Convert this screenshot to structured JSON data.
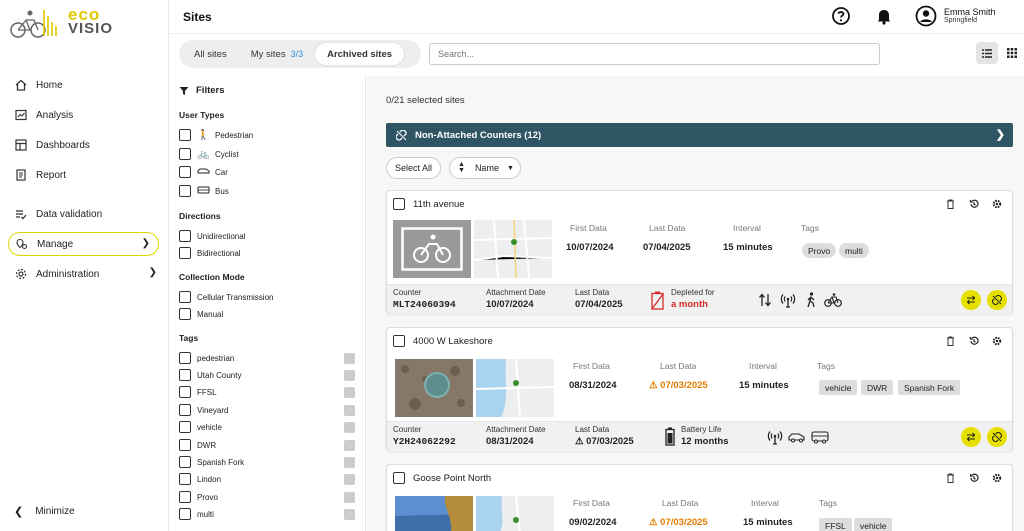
{
  "app": {
    "logo_top": "eco",
    "logo_bottom": "VISIO"
  },
  "sidebar": {
    "items": [
      {
        "label": "Home",
        "icon": "home-icon"
      },
      {
        "label": "Analysis",
        "icon": "analysis-icon"
      },
      {
        "label": "Dashboards",
        "icon": "dashboards-icon"
      },
      {
        "label": "Report",
        "icon": "report-icon"
      },
      {
        "label": "Data validation",
        "icon": "data-validation-icon"
      },
      {
        "label": "Manage",
        "icon": "manage-icon"
      },
      {
        "label": "Administration",
        "icon": "administration-icon"
      }
    ],
    "minimize": "Minimize"
  },
  "header": {
    "title": "Sites",
    "user_name": "Emma Smith",
    "user_city": "Springfield"
  },
  "toolbar": {
    "tabs": [
      {
        "label": "All sites",
        "count": ""
      },
      {
        "label": "My sites",
        "count": "3/3"
      },
      {
        "label": "Archived sites",
        "count": ""
      }
    ],
    "search_placeholder": "Search..."
  },
  "filters": {
    "title": "Filters",
    "user_types_title": "User Types",
    "user_types": [
      "Pedestrian",
      "Cyclist",
      "Car",
      "Bus"
    ],
    "directions_title": "Directions",
    "directions": [
      "Unidirectional",
      "Bidirectional"
    ],
    "collection_title": "Collection Mode",
    "collection": [
      "Cellular Transmission",
      "Manual"
    ],
    "tags_title": "Tags",
    "tags": [
      "pedestrian",
      "Utah County",
      "FFSL",
      "Vineyard",
      "vehicle",
      "DWR",
      "Spanish Fork",
      "Lindon",
      "Provo",
      "multi"
    ]
  },
  "main": {
    "selected": "0/21 selected sites",
    "non_attached": "Non-Attached Counters (12)",
    "select_all": "Select All",
    "sort": "Name"
  },
  "labels": {
    "first_data": "First Data",
    "last_data": "Last Data",
    "interval": "Interval",
    "tags": "Tags",
    "counter": "Counter",
    "attachment_date": "Attachment Date",
    "battery_life": "Battery Life"
  },
  "cards": [
    {
      "name": "11th avenue",
      "first_data": "10/07/2024",
      "last_data": "07/04/2025",
      "interval": "15 minutes",
      "tags": [
        "Provo",
        "multi"
      ],
      "counter": "MLT24060394",
      "attachment_date": "10/07/2024",
      "foot_last_data": "07/04/2025",
      "status_label": "Depleted for",
      "status_value": "a month"
    },
    {
      "name": "4000 W Lakeshore",
      "first_data": "08/31/2024",
      "last_data": "07/03/2025",
      "interval": "15 minutes",
      "tags": [
        "vehicle",
        "DWR",
        "Spanish Fork"
      ],
      "counter": "Y2H24062292",
      "attachment_date": "08/31/2024",
      "foot_last_data": "07/03/2025",
      "status_label": "Battery Life",
      "status_value": "12 months"
    },
    {
      "name": "Goose Point North",
      "first_data": "09/02/2024",
      "last_data": "07/03/2025",
      "interval": "15 minutes",
      "tags": [
        "FFSL",
        "vehicle"
      ]
    }
  ],
  "colors": {
    "accent": "#e6e000",
    "header_bar": "#2f5565",
    "warning": "#e57c00",
    "danger": "#d62a2a",
    "link": "#2e8bd6"
  }
}
